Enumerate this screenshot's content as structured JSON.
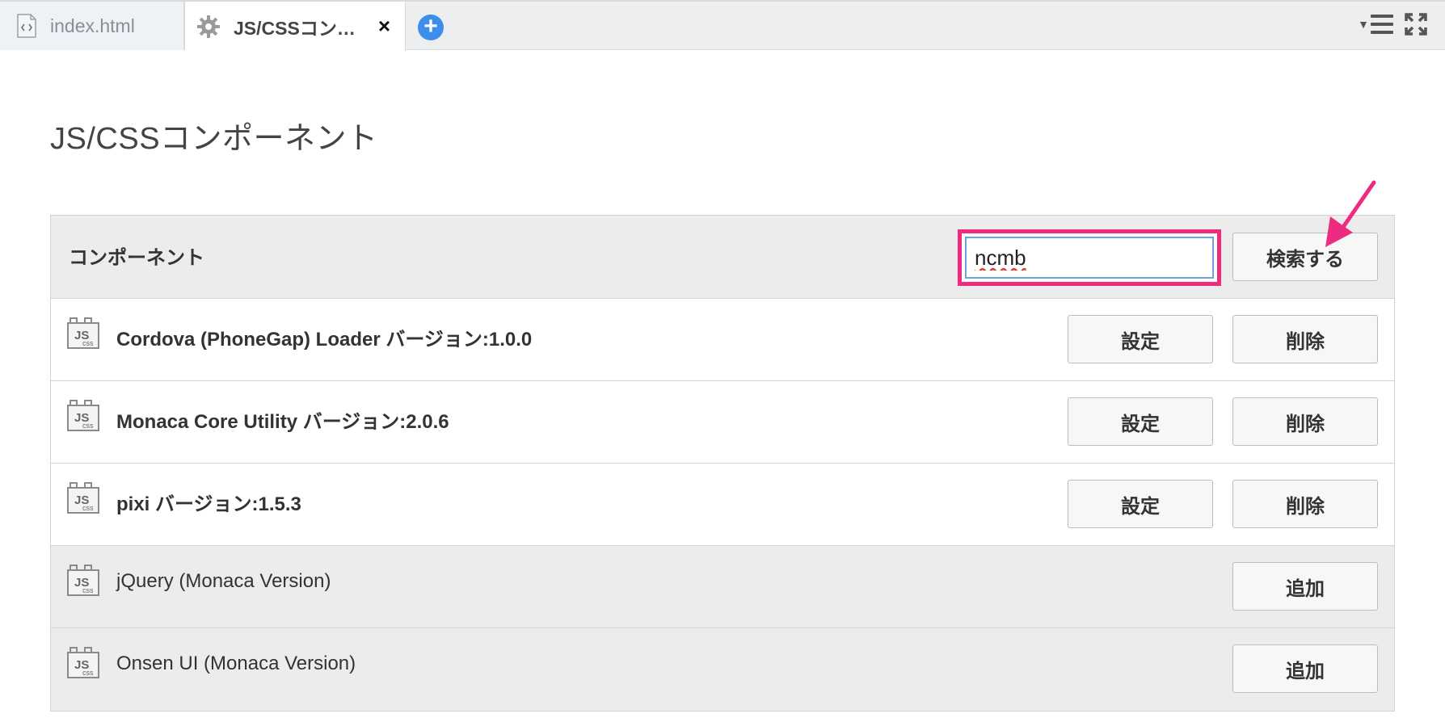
{
  "tabs": [
    {
      "label": "index.html",
      "icon": "html-file-icon",
      "active": false
    },
    {
      "label": "JS/CSSコン…",
      "icon": "gear-icon",
      "active": true,
      "close_label": "×"
    }
  ],
  "tab_add_label": "+",
  "page_title": "JS/CSSコンポーネント",
  "header": {
    "label": "コンポーネント",
    "search_value": "ncmb",
    "search_button": "検索する"
  },
  "installed": [
    {
      "name": "Cordova (PhoneGap) Loader バージョン:1.0.0",
      "settings_label": "設定",
      "delete_label": "削除"
    },
    {
      "name": "Monaca Core Utility バージョン:2.0.6",
      "settings_label": "設定",
      "delete_label": "削除"
    },
    {
      "name": "pixi バージョン:1.5.3",
      "settings_label": "設定",
      "delete_label": "削除"
    }
  ],
  "available": [
    {
      "name": "jQuery (Monaca Version)",
      "add_label": "追加"
    },
    {
      "name": "Onsen UI (Monaca Version)",
      "add_label": "追加"
    }
  ],
  "colors": {
    "highlight": "#ef2b7f",
    "accent_blue": "#3d8eea"
  }
}
